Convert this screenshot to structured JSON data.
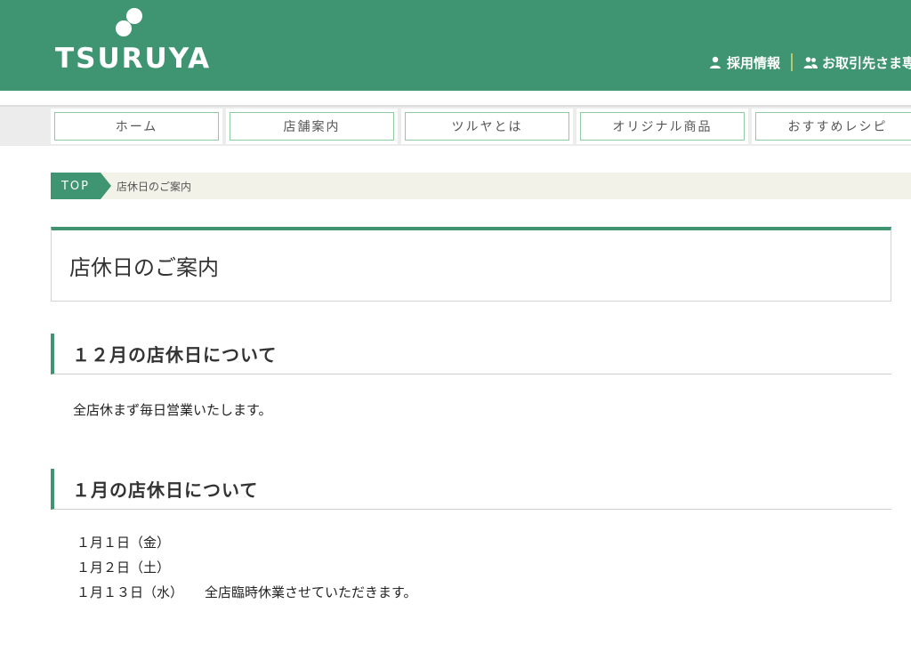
{
  "header": {
    "logo_text": "TSURUYA",
    "links": [
      {
        "label": "採用情報",
        "icon": "person-icon"
      },
      {
        "label": "お取引先さま専用",
        "icon": "people-icon"
      }
    ],
    "colors": {
      "brand": "#3f9471",
      "separator": "#b9c86a"
    }
  },
  "nav": {
    "items": [
      {
        "label": "ホーム"
      },
      {
        "label": "店舗案内"
      },
      {
        "label": "ツルヤとは"
      },
      {
        "label": "オリジナル商品"
      },
      {
        "label": "おすすめレシピ"
      }
    ]
  },
  "breadcrumb": {
    "top": "TOP",
    "current": "店休日のご案内"
  },
  "page": {
    "title": "店休日のご案内"
  },
  "sections": [
    {
      "heading": "１２月の店休日について",
      "text": "全店休まず毎日営業いたします。"
    },
    {
      "heading": "１月の店休日について",
      "items": [
        {
          "date": "１月１日（金）",
          "note": ""
        },
        {
          "date": "１月２日（土）",
          "note": ""
        },
        {
          "date": "１月１３日（水）",
          "note": "全店臨時休業させていただきます。"
        }
      ]
    }
  ]
}
